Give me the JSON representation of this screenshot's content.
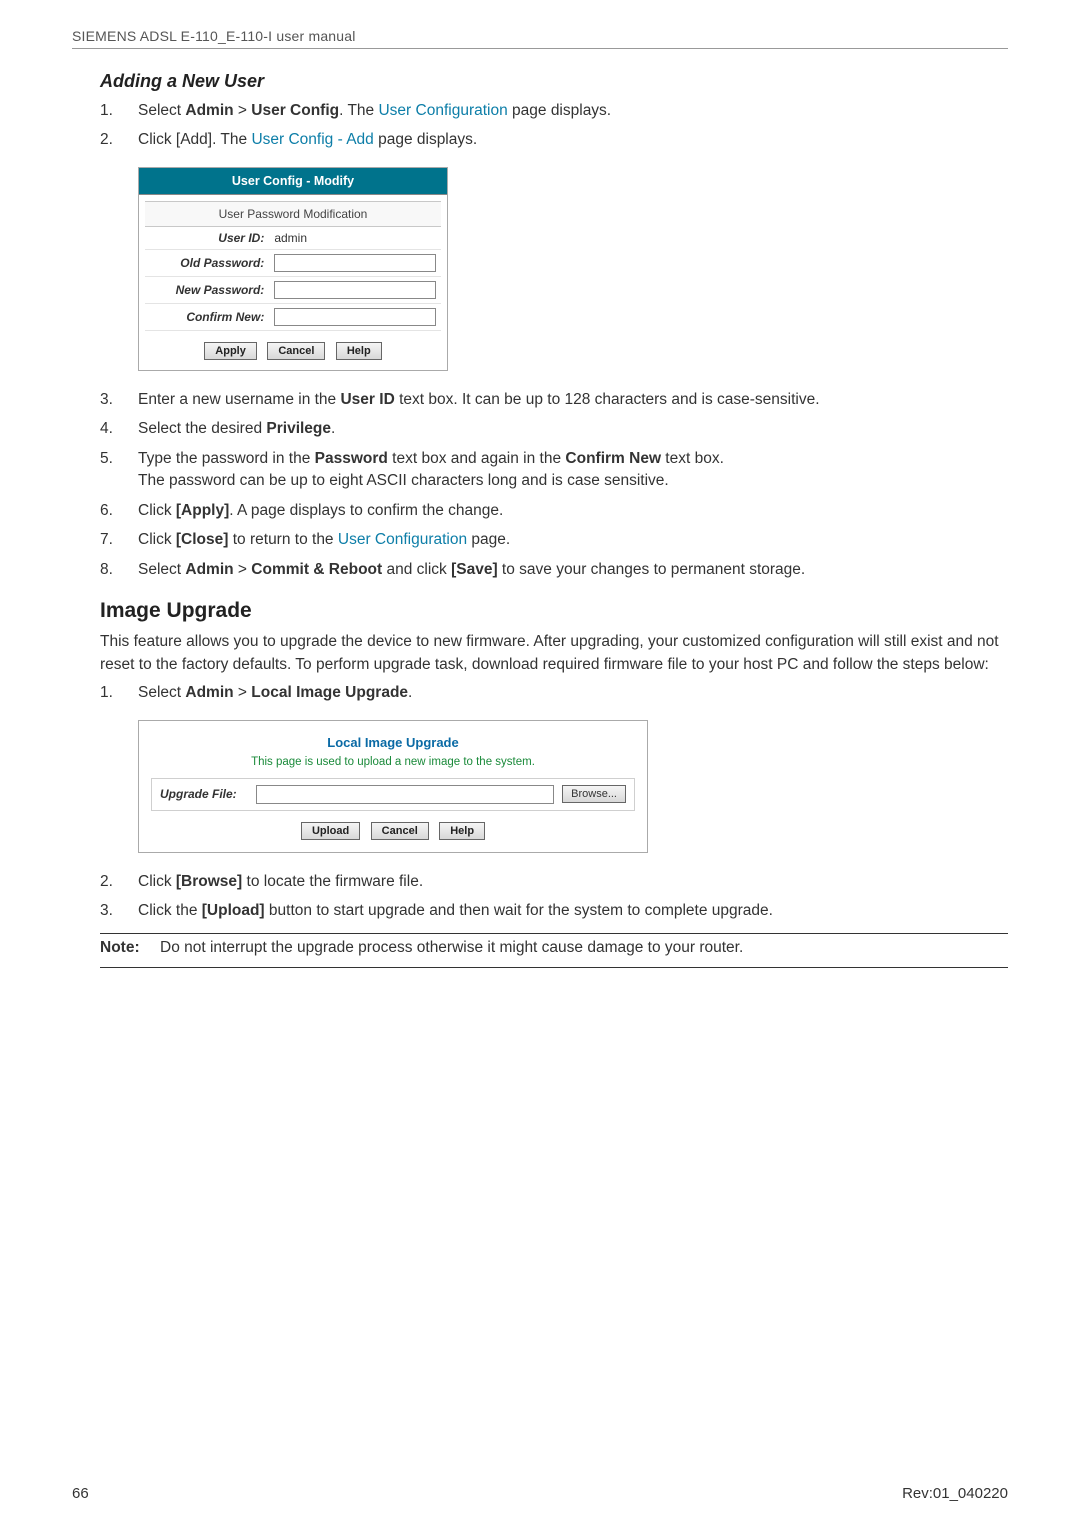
{
  "header": "SIEMENS ADSL E-110_E-110-I user manual",
  "section1": {
    "title": "Adding a New User",
    "step1": {
      "num": "1.",
      "pre": "Select ",
      "b1": "Admin",
      "gt": " > ",
      "b2": "User Config",
      "mid": ". The ",
      "link": "User Configuration",
      "post": " page displays."
    },
    "step2": {
      "num": "2.",
      "pre": "Click [Add]. The ",
      "link": "User Config - Add",
      "post": " page displays."
    },
    "fig": {
      "title": "User Config - Modify",
      "subtitle": "User Password Modification",
      "user_id_label": "User ID:",
      "user_id_value": "admin",
      "old_pw_label": "Old Password:",
      "new_pw_label": "New Password:",
      "confirm_label": "Confirm New:",
      "btn_apply": "Apply",
      "btn_cancel": "Cancel",
      "btn_help": "Help"
    },
    "step3": {
      "num": "3.",
      "pre": "Enter a new username in the ",
      "b": "User ID",
      "post": " text box. It can be up to 128 characters and is case-sensitive."
    },
    "step4": {
      "num": "4.",
      "pre": "Select the desired ",
      "b": "Privilege",
      "post": "."
    },
    "step5": {
      "num": "5.",
      "l1a": "Type the password in the ",
      "b1": "Password",
      "l1b": " text box and again in the ",
      "b2": "Confirm New",
      "l1c": " text box.",
      "l2": "The password can be up to eight ASCII characters long and is case sensitive."
    },
    "step6": {
      "num": "6.",
      "pre": "Click ",
      "b": "[Apply]",
      "post": ". A page displays to confirm the change."
    },
    "step7": {
      "num": "7.",
      "pre": "Click ",
      "b": "[Close]",
      "mid": " to return to the ",
      "link": "User Configuration",
      "post": " page."
    },
    "step8": {
      "num": "8.",
      "pre": "Select ",
      "b1": "Admin",
      "gt": " > ",
      "b2": "Commit & Reboot",
      "mid": " and click ",
      "b3": "[Save]",
      "post": " to save your changes to permanent storage."
    }
  },
  "section2": {
    "title": "Image Upgrade",
    "para": "This feature allows you to upgrade the device to new firmware. After upgrading, your customized configuration will still exist and not reset to the factory defaults. To perform upgrade task, download required firmware file to your host PC and follow the steps below:",
    "step1": {
      "num": "1.",
      "pre": "Select ",
      "b1": "Admin",
      "gt": " > ",
      "b2": "Local Image Upgrade",
      "post": "."
    },
    "fig": {
      "title": "Local Image Upgrade",
      "sub": "This page is used to upload a new image to the system.",
      "label": "Upgrade File:",
      "browse": "Browse...",
      "btn_upload": "Upload",
      "btn_cancel": "Cancel",
      "btn_help": "Help"
    },
    "step2": {
      "num": "2.",
      "pre": "Click ",
      "b": "[Browse]",
      "post": " to locate the firmware file."
    },
    "step3": {
      "num": "3.",
      "pre": "Click the ",
      "b": "[Upload]",
      "post": " button to start upgrade and then wait for the system to complete upgrade."
    },
    "note_label": "Note:",
    "note_text": "Do not interrupt the upgrade process otherwise it might cause damage to your router."
  },
  "footer": {
    "left": "66",
    "right": "Rev:01_040220"
  }
}
